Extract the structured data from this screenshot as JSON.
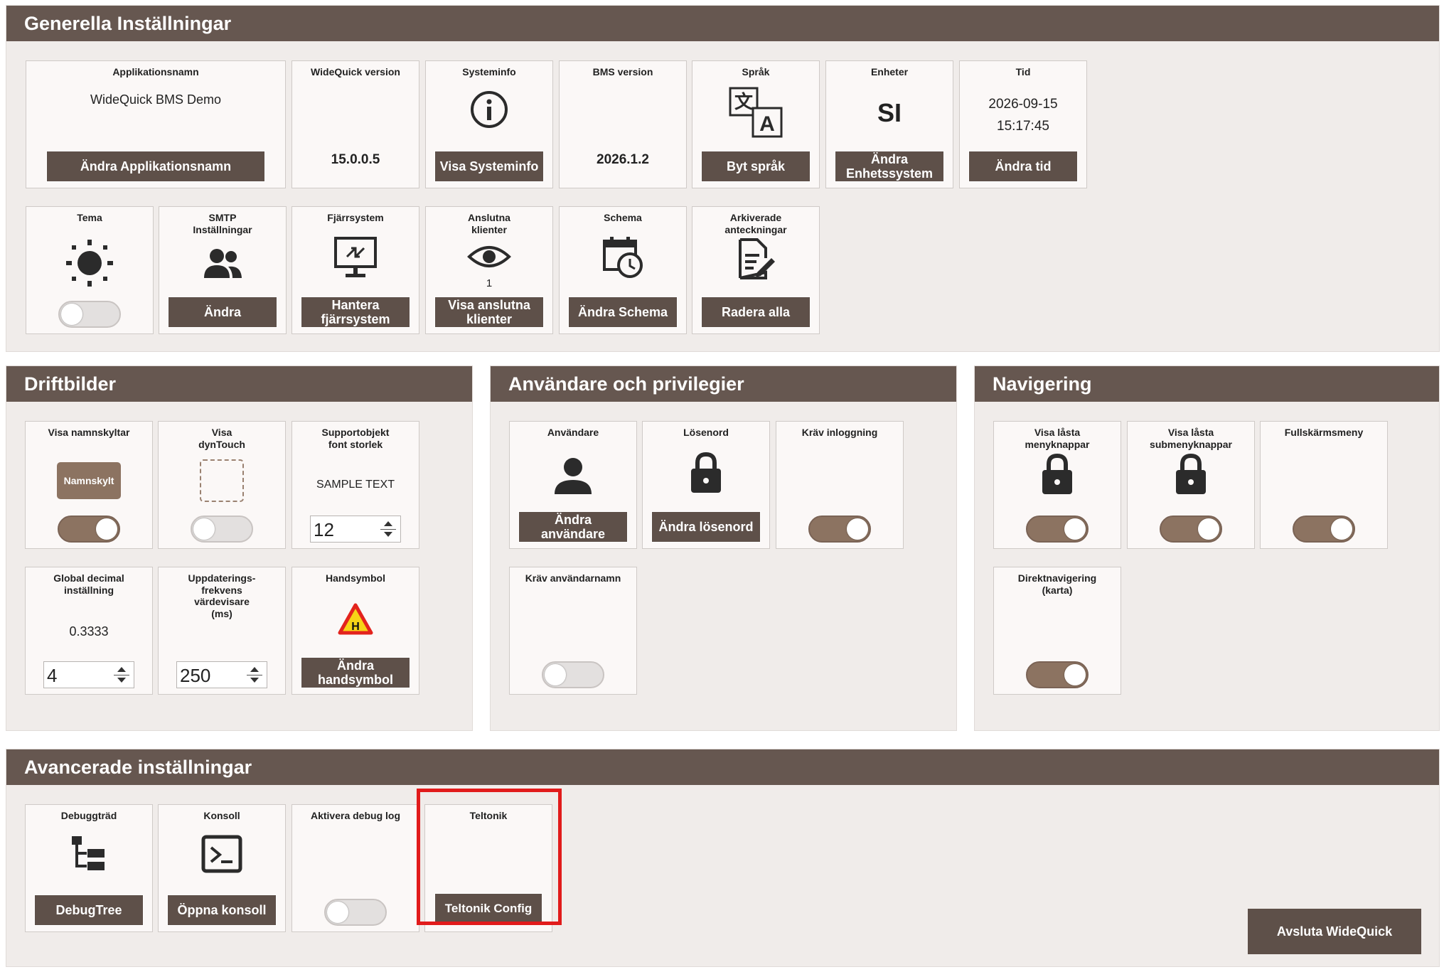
{
  "sections": {
    "general": "Generella Inställningar",
    "operation": "Driftbilder",
    "users": "Användare och privilegier",
    "navigation": "Navigering",
    "advanced": "Avancerade inställningar"
  },
  "general": {
    "app_name": {
      "title": "Applikationsnamn",
      "value": "WideQuick BMS Demo",
      "button": "Ändra Applikationsnamn"
    },
    "widequick_version": {
      "title": "WideQuick version",
      "value": "15.0.0.5"
    },
    "system_info": {
      "title": "Systeminfo",
      "button": "Visa Systeminfo",
      "icon": "info-icon"
    },
    "bms_version": {
      "title": "BMS version",
      "value": "2026.1.2"
    },
    "language": {
      "title": "Språk",
      "button": "Byt språk",
      "icon": "translate-icon"
    },
    "units": {
      "title": "Enheter",
      "value": "SI",
      "button": "Ändra Enhetssystem"
    },
    "time": {
      "title": "Tid",
      "date": "2026-09-15",
      "clock": "15:17:45",
      "button": "Ändra tid"
    },
    "theme": {
      "title": "Tema",
      "enabled": false,
      "icon": "sun-icon"
    },
    "smtp": {
      "title": "SMTP Inställningar",
      "button": "Ändra",
      "icon": "users-icon"
    },
    "remote": {
      "title": "Fjärrsystem",
      "button": "Hantera fjärrsystem",
      "icon": "remote-desktop-icon"
    },
    "clients": {
      "title": "Anslutna klienter",
      "count": "1",
      "button": "Visa anslutna klienter",
      "icon": "eye-icon"
    },
    "schedule": {
      "title": "Schema",
      "button": "Ändra Schema",
      "icon": "calendar-clock-icon"
    },
    "archived_notes": {
      "title": "Arkiverade anteckningar",
      "button": "Radera alla",
      "icon": "document-edit-icon"
    }
  },
  "operation": {
    "show_nameplates": {
      "title": "Visa namnskyltar",
      "chip": "Namnskylt",
      "enabled": true
    },
    "show_dyntouch": {
      "title": "Visa dynTouch",
      "enabled": false
    },
    "support_font": {
      "title": "Supportobjekt font storlek",
      "sample": "SAMPLE TEXT",
      "value": "12"
    },
    "global_decimal": {
      "title": "Global decimal inställning",
      "preview": "0.3333",
      "value": "4"
    },
    "update_freq": {
      "title": "Uppdaterings-frekvens värdevisare (ms)",
      "value": "250"
    },
    "hand_symbol": {
      "title": "Handsymbol",
      "button": "Ändra handsymbol",
      "icon": "hand-warning-icon",
      "symbol_letter": "H"
    }
  },
  "users": {
    "user": {
      "title": "Användare",
      "button": "Ändra användare",
      "icon": "user-icon"
    },
    "password": {
      "title": "Lösenord",
      "button": "Ändra lösenord",
      "icon": "lock-icon"
    },
    "require_login": {
      "title": "Kräv inloggning",
      "enabled": true
    },
    "require_username": {
      "title": "Kräv användarnamn",
      "enabled": false
    }
  },
  "navigation": {
    "locked_menu": {
      "title": "Visa låsta menyknappar",
      "enabled": true,
      "icon": "lock-icon"
    },
    "locked_submenu": {
      "title": "Visa låsta submenyknappar",
      "enabled": true,
      "icon": "lock-icon"
    },
    "fullscreen_menu": {
      "title": "Fullskärmsmeny",
      "enabled": true
    },
    "direct_nav": {
      "title": "Direktnavigering (karta)",
      "enabled": true
    }
  },
  "advanced": {
    "debug_tree": {
      "title": "Debuggträd",
      "button": "DebugTree",
      "icon": "tree-icon"
    },
    "console": {
      "title": "Konsoll",
      "button": "Öppna konsoll",
      "icon": "terminal-icon"
    },
    "debug_log": {
      "title": "Aktivera debug log",
      "enabled": false
    },
    "teltonik": {
      "title": "Teltonik",
      "button": "Teltonik Config"
    }
  },
  "exit_button": "Avsluta WideQuick",
  "colors": {
    "header": "#665750",
    "button": "#5e5049",
    "toggle_on": "#8c7361",
    "highlight": "#e11b1b"
  }
}
